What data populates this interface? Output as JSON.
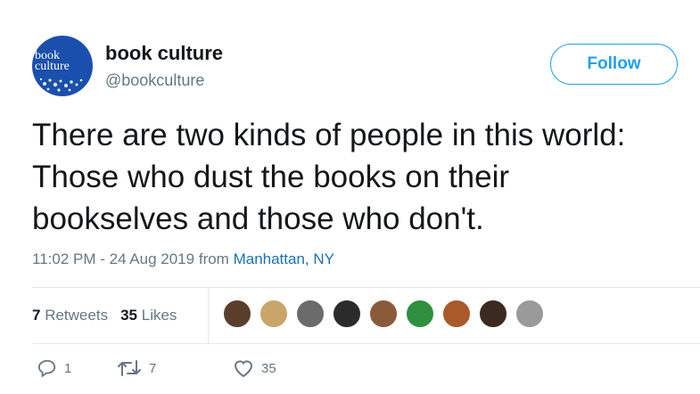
{
  "profile": {
    "avatar_text": "book\nculture",
    "name": "book culture",
    "handle": "@bookculture"
  },
  "follow_button": {
    "label": "Follow"
  },
  "tweet": {
    "lines": [
      "There are two kinds of people in this world:",
      "Those who dust the books on their",
      "bookselves and those who don't."
    ]
  },
  "meta": {
    "time_date": "11:02 PM - 24 Aug 2019",
    "from_word": "from",
    "location": "Manhattan, NY"
  },
  "stats": {
    "retweets_count": "7",
    "retweets_label": "Retweets",
    "likes_count": "35",
    "likes_label": "Likes"
  },
  "likers": [
    {
      "icon": "user-avatar-1",
      "color": "#5a3e2b"
    },
    {
      "icon": "user-avatar-2",
      "color": "#c9a56a"
    },
    {
      "icon": "user-avatar-3",
      "color": "#6b6b6b"
    },
    {
      "icon": "user-avatar-4",
      "color": "#2b2b2b"
    },
    {
      "icon": "user-avatar-5",
      "color": "#8a5a3a"
    },
    {
      "icon": "user-avatar-6",
      "color": "#2f8f3f"
    },
    {
      "icon": "user-avatar-7",
      "color": "#a85a2a"
    },
    {
      "icon": "user-avatar-8",
      "color": "#3a2a20"
    },
    {
      "icon": "user-avatar-9",
      "color": "#9a9a9a"
    }
  ],
  "actions": {
    "reply_count": "1",
    "retweet_count": "7",
    "like_count": "35"
  },
  "colors": {
    "accent": "#1da1f2",
    "link": "#1b6fb5",
    "muted": "#657786",
    "avatar_bg": "#1a4fae"
  }
}
